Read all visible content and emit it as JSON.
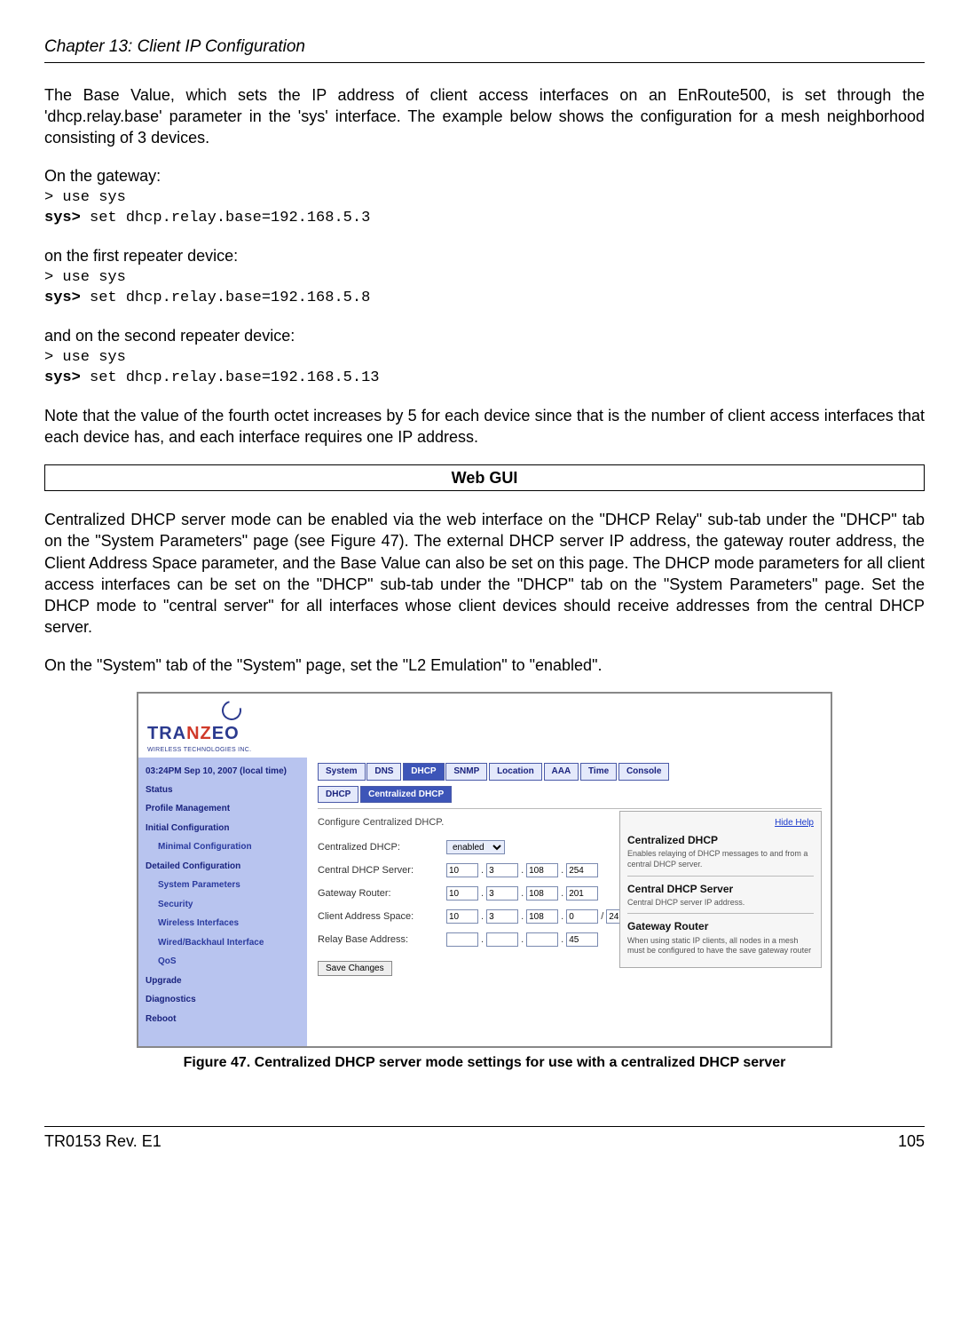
{
  "chapter_header": "Chapter 13: Client IP Configuration",
  "para1": "The Base Value, which sets the IP address of client access interfaces on an EnRoute500, is set through the 'dhcp.relay.base' parameter in the 'sys' interface. The example below shows the configuration for a mesh neighborhood consisting of 3 devices.",
  "gateway_label": "On the gateway:",
  "code1_l1": "> use sys",
  "code1_l2a": "sys>",
  "code1_l2b": " set dhcp.relay.base=192.168.5.3",
  "repeater1_label": "on the first repeater device:",
  "code2_l1": "> use sys",
  "code2_l2a": "sys>",
  "code2_l2b": " set dhcp.relay.base=192.168.5.8",
  "repeater2_label": "and on the second repeater device:",
  "code3_l1": "> use sys",
  "code3_l2a": "sys>",
  "code3_l2b": " set dhcp.relay.base=192.168.5.13",
  "para_note": "Note that the value of the fourth octet increases by 5 for each device since that is the number of client access interfaces that each device has, and each interface requires one IP address.",
  "webgui_heading": "Web GUI",
  "para_webgui": "Centralized DHCP server mode can be enabled via the web interface on the \"DHCP Relay\" sub-tab under the \"DHCP\" tab on the \"System Parameters\" page (see Figure 47). The external DHCP server IP address, the gateway router address, the Client Address Space parameter, and the Base Value can also be set on this page. The DHCP mode parameters for all client access interfaces can be set on the \"DHCP\" sub-tab under the \"DHCP\" tab on the \"System Parameters\" page. Set the DHCP mode to \"central server\" for all interfaces whose client devices should receive addresses from the central DHCP server.",
  "para_system": "On the \"System\" tab of the \"System\" page, set the \"L2 Emulation\" to \"enabled\".",
  "figure_caption": "Figure 47. Centralized DHCP server mode settings for use with a centralized DHCP server",
  "footer_left": "TR0153 Rev. E1",
  "footer_right": "105",
  "screenshot": {
    "logo_main_pre": "TRA",
    "logo_main_mid": "NZ",
    "logo_main_post": "EO",
    "logo_sub": "WIRELESS TECHNOLOGIES INC.",
    "sidebar": {
      "time": "03:24PM Sep 10, 2007 (local time)",
      "items": [
        "Status",
        "Profile Management",
        "Initial Configuration",
        "Minimal Configuration",
        "Detailed Configuration",
        "System Parameters",
        "Security",
        "Wireless Interfaces",
        "Wired/Backhaul Interface",
        "QoS",
        "Upgrade",
        "Diagnostics",
        "Reboot"
      ]
    },
    "tabs_top": [
      "System",
      "DNS",
      "DHCP",
      "SNMP",
      "Location",
      "AAA",
      "Time",
      "Console"
    ],
    "tabs_sub": [
      "DHCP",
      "Centralized DHCP"
    ],
    "conf_text": "Configure Centralized DHCP.",
    "form": {
      "centralized_label": "Centralized DHCP:",
      "centralized_value": "enabled",
      "server_label": "Central DHCP Server:",
      "server_ip": [
        "10",
        "3",
        "108",
        "254"
      ],
      "gateway_label": "Gateway Router:",
      "gateway_ip": [
        "10",
        "3",
        "108",
        "201"
      ],
      "space_label": "Client Address Space:",
      "space_ip": [
        "10",
        "3",
        "108",
        "0"
      ],
      "space_mask": "24",
      "relay_label": "Relay Base Address:",
      "relay_ip": [
        "",
        "",
        "",
        "45"
      ],
      "save_btn": "Save Changes"
    },
    "help": {
      "hide": "Hide Help",
      "t1": "Centralized DHCP",
      "d1": "Enables relaying of DHCP messages to and from a central DHCP server.",
      "t2": "Central DHCP Server",
      "d2": "Central DHCP server IP address.",
      "t3": "Gateway Router",
      "d3": "When using static IP clients, all nodes in a mesh must be configured to have the save gateway router"
    }
  }
}
